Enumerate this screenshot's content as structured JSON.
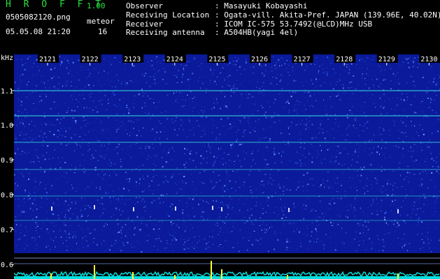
{
  "header": {
    "app_title": "H R O F F T",
    "version": "1.00",
    "filename": "0505082120.png",
    "datetime": "05.05.08 21:20",
    "meteor_label": "meteor",
    "meteor_count": "16",
    "observer_label": "Observer",
    "observer_value": ": Masayuki Kobayashi",
    "location_label": "Receiving Location",
    "location_value": ": Ogata-vill. Akita-Pref. JAPAN (139.96E, 40.02N)",
    "receiver_label": "Receiver",
    "receiver_value": ": ICOM IC-575 53.7492(@LCD)MHz USB",
    "antenna_label": "Receiving antenna",
    "antenna_value": ": A504HB(yagi 4el)"
  },
  "plot": {
    "y_unit": "kHz",
    "y_ticks": [
      "1.1",
      "1.0",
      "0.9",
      "0.8",
      "0.7",
      "0.6"
    ],
    "x_ticks": [
      "2121",
      "2122",
      "2123",
      "2124",
      "2125",
      "2126",
      "2127",
      "2128",
      "2129",
      "2130"
    ],
    "colors": {
      "background": "#0a1a9a",
      "noise_bright": "#3a6cff",
      "carrier": "#38e0e0",
      "level_trace": "#00e0e0",
      "spike": "#ffff30",
      "axis_text": "#ffffff"
    }
  }
}
